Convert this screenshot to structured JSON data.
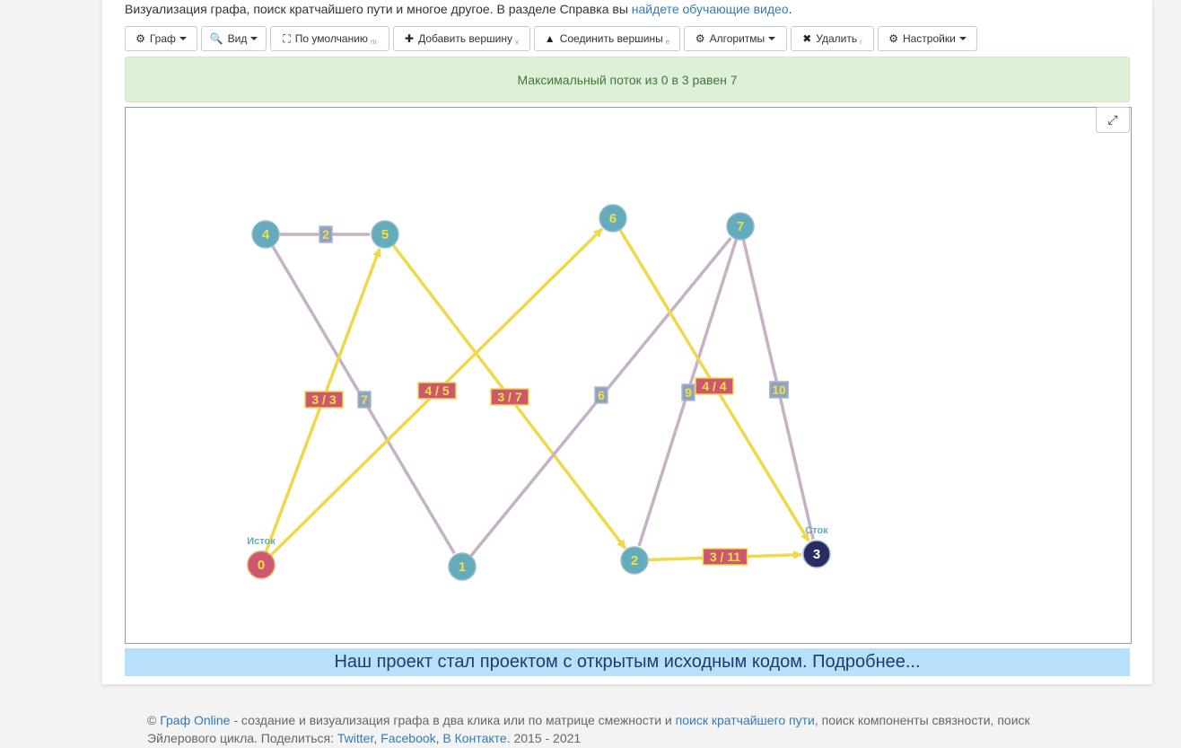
{
  "intro": {
    "text": "Визуализация графа, поиск кратчайшего пути и многое другое. В разделе Справка вы ",
    "link": "найдете обучающие видео",
    "tail": "."
  },
  "toolbar": [
    {
      "id": "graph",
      "icon": "⚙",
      "label": "Граф",
      "caret": true,
      "hotkey": ""
    },
    {
      "id": "view",
      "icon": "🔍",
      "label": "Вид",
      "caret": true,
      "hotkey": ""
    },
    {
      "id": "default",
      "icon": "⛶",
      "label": "По умолчанию",
      "caret": false,
      "hotkey": "m"
    },
    {
      "id": "add-vertex",
      "icon": "✚",
      "label": "Добавить вершину",
      "caret": false,
      "hotkey": "v"
    },
    {
      "id": "connect",
      "icon": "▲",
      "label": "Соединить вершины",
      "caret": false,
      "hotkey": "e"
    },
    {
      "id": "algorithms",
      "icon": "⚙",
      "label": "Алгоритмы",
      "caret": true,
      "hotkey": ""
    },
    {
      "id": "delete",
      "icon": "✖",
      "label": "Удалить",
      "caret": false,
      "hotkey": "r"
    },
    {
      "id": "settings",
      "icon": "⚙",
      "label": "Настройки",
      "caret": true,
      "hotkey": ""
    }
  ],
  "alert": "Максимальный поток из 0 в 3 равен 7",
  "banner": "Наш проект стал проектом с открытым исходным кодом. Подробнее...",
  "colors": {
    "node": "#63abbd",
    "source": "#cc5870",
    "sink": "#2b2b63",
    "flow_edge": "#f0d848",
    "edge": "#c5b2c6",
    "flow_label_bg": "#cc5870",
    "weight_label_bg": "#8fa0c0",
    "label_text": "#f0e040"
  },
  "graph": {
    "nodes": [
      {
        "id": "0",
        "role": "source",
        "tag": "Исток"
      },
      {
        "id": "1",
        "role": "normal",
        "tag": ""
      },
      {
        "id": "2",
        "role": "normal",
        "tag": ""
      },
      {
        "id": "3",
        "role": "sink",
        "tag": "Сток"
      },
      {
        "id": "4",
        "role": "normal",
        "tag": ""
      },
      {
        "id": "5",
        "role": "normal",
        "tag": ""
      },
      {
        "id": "6",
        "role": "normal",
        "tag": ""
      },
      {
        "id": "7",
        "role": "normal",
        "tag": ""
      }
    ],
    "edges": [
      {
        "from": "4",
        "to": "5",
        "label": "2",
        "flow": false
      },
      {
        "from": "4",
        "to": "1",
        "label": "7",
        "flow": false
      },
      {
        "from": "0",
        "to": "5",
        "label": "3 / 3",
        "flow": true
      },
      {
        "from": "0",
        "to": "6",
        "label": "4 / 5",
        "flow": true
      },
      {
        "from": "5",
        "to": "2",
        "label": "3 / 7",
        "flow": true
      },
      {
        "from": "1",
        "to": "7",
        "label": "6",
        "flow": false
      },
      {
        "from": "7",
        "to": "2",
        "label": "9",
        "flow": false
      },
      {
        "from": "6",
        "to": "3",
        "label": "4 / 4",
        "flow": true
      },
      {
        "from": "7",
        "to": "3",
        "label": "10",
        "flow": false
      },
      {
        "from": "2",
        "to": "3",
        "label": "3 / 11",
        "flow": true
      }
    ]
  },
  "footer": {
    "copy": "© ",
    "brand": "Граф Online",
    "text1": " - создание и визуализация графа в два клика или по матрице смежности и ",
    "link1": "поиск кратчайшего пути",
    "text2": ", поиск компоненты связности, поиск Эйлерового цикла. Поделиться: ",
    "twitter": "Twitter",
    "sep1": ", ",
    "facebook": "Facebook",
    "sep2": ", ",
    "vk": "В Контакте",
    "years": ". 2015 - 2021"
  }
}
